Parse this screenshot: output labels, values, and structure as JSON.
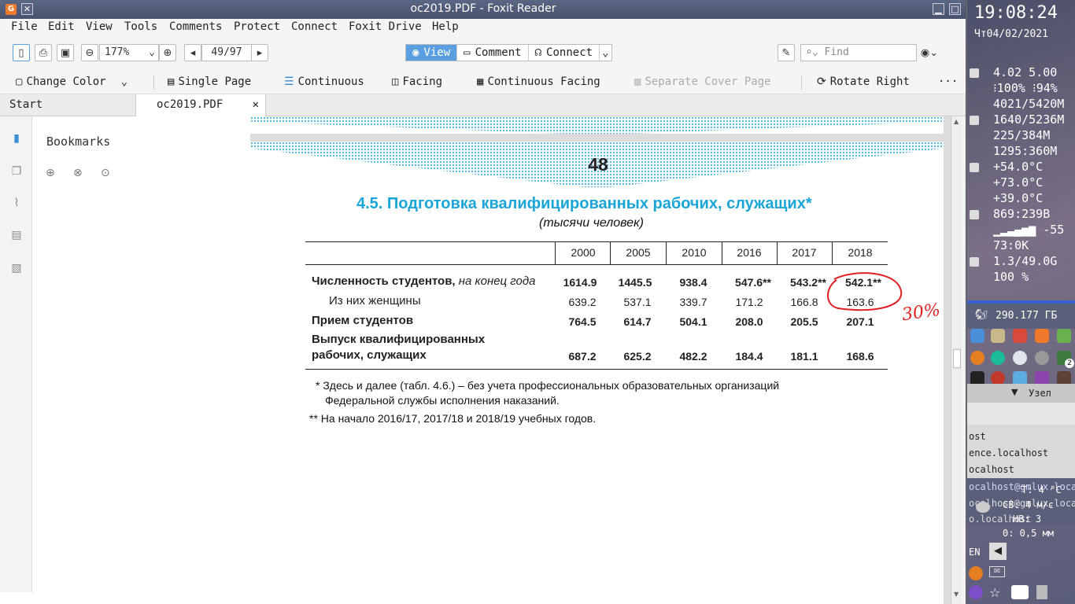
{
  "window": {
    "title": "oc2019.PDF - Foxit Reader"
  },
  "menu": [
    "File",
    "Edit",
    "View",
    "Tools",
    "Comments",
    "Protect",
    "Connect",
    "Foxit Drive",
    "Help"
  ],
  "toolbar": {
    "zoom": "177%",
    "page": "49/97",
    "modes": {
      "view": "View",
      "comment": "Comment",
      "connect": "Connect"
    },
    "find_placeholder": "Find"
  },
  "toolbar2": {
    "change_color": "Change Color",
    "single_page": "Single Page",
    "continuous": "Continuous",
    "facing": "Facing",
    "continuous_facing": "Continuous Facing",
    "separate_cover": "Separate Cover Page",
    "rotate_right": "Rotate Right",
    "more": "···"
  },
  "tabs": {
    "start": "Start",
    "doc": "oc2019.PDF",
    "close": "✕"
  },
  "panel": {
    "bookmarks": "Bookmarks"
  },
  "pdf": {
    "page_number": "48",
    "title": "4.5. Подготовка квалифицированных рабочих, служащих*",
    "subtitle": "(тысячи человек)",
    "years": [
      "2000",
      "2005",
      "2010",
      "2016",
      "2017",
      "2018"
    ],
    "rows": [
      {
        "label_bold": "Численность студентов,",
        "label_italic": " на конец года",
        "values": [
          "1614.9",
          "1445.5",
          "938.4",
          "547.6**",
          "543.2**",
          "542.1**"
        ]
      },
      {
        "label": "Из них женщины",
        "values": [
          "639.2",
          "537.1",
          "339.7",
          "171.2",
          "166.8",
          "163.6"
        ]
      },
      {
        "label_bold": "Прием студентов",
        "values": [
          "764.5",
          "614.7",
          "504.1",
          "208.0",
          "205.5",
          "207.1"
        ]
      },
      {
        "label_bold1": "Выпуск квалифицированных",
        "label_bold2": "рабочих, служащих",
        "values": [
          "687.2",
          "625.2",
          "482.2",
          "184.4",
          "181.1",
          "168.6"
        ]
      }
    ],
    "note1a": "* Здесь и далее (табл. 4.6.) – без учета профессиональных образовательных организаций",
    "note1b": "Федеральной службы исполнения наказаний.",
    "note2": "** На начало 2016/17, 2017/18 и 2018/19 учебных годов.",
    "annotation": "30%"
  },
  "desktop": {
    "time": "19:08:24",
    "date": "Чт04/02/2021",
    "stats": [
      "4.02 5.00",
      "⁝100% ⁝94%",
      "4021/5420M",
      "1640/5236M",
      "225/384M",
      "1295:360M",
      "+54.0°C",
      "+73.0°C",
      "+39.0°C",
      "869:239B",
      "▁▂▃▄▅▆ -55",
      "73:0K",
      "1.3/49.0G",
      "100 %"
    ],
    "disk": "290.177 ГБ",
    "list": [
      "ost",
      "ence.localhost",
      "ocalhost",
      "ocalhost@gmlux.local",
      "ocalhost@gmlux.loca",
      "o.localhost"
    ],
    "weather": {
      "t": "T: 4 °C",
      "wind": "СВ: 4 м/с",
      "nv": "НВ: 3",
      "rain": "0: 0,5 мм"
    },
    "lang": "EN",
    "badge": "2",
    "node": "Узел"
  }
}
